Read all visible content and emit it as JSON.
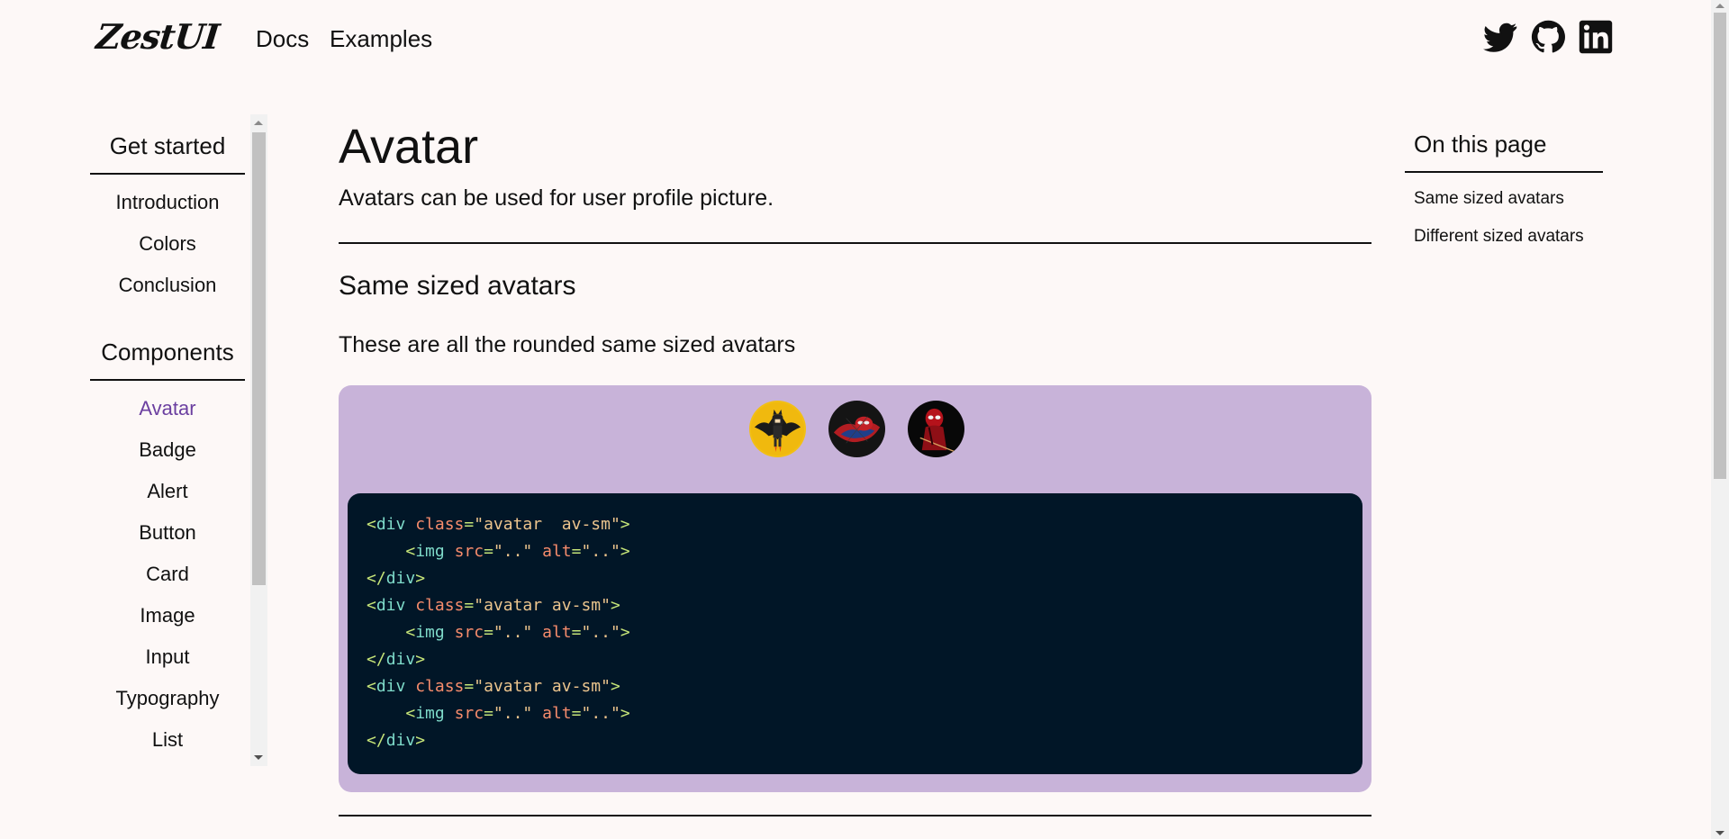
{
  "header": {
    "logo": "ZestUI",
    "nav": [
      {
        "label": "Docs"
      },
      {
        "label": "Examples"
      }
    ],
    "social_icons": [
      "twitter-icon",
      "github-icon",
      "linkedin-icon"
    ]
  },
  "sidebar": {
    "get_started_heading": "Get started",
    "get_started_items": [
      {
        "label": "Introduction"
      },
      {
        "label": "Colors"
      },
      {
        "label": "Conclusion"
      }
    ],
    "components_heading": "Components",
    "components_items": [
      {
        "label": "Avatar",
        "active": true
      },
      {
        "label": "Badge"
      },
      {
        "label": "Alert"
      },
      {
        "label": "Button"
      },
      {
        "label": "Card"
      },
      {
        "label": "Image"
      },
      {
        "label": "Input"
      },
      {
        "label": "Typography"
      },
      {
        "label": "List"
      }
    ]
  },
  "main": {
    "title": "Avatar",
    "description": "Avatars can be used for user profile picture.",
    "section_title": "Same sized avatars",
    "section_description": "These are all the rounded same sized avatars",
    "avatars": [
      "batman-avatar",
      "spiderman-avatar",
      "deadpool-avatar"
    ],
    "code_lines": [
      [
        [
          "<",
          "punc"
        ],
        [
          "div",
          "tag"
        ],
        [
          " ",
          "txt"
        ],
        [
          "class",
          "attr"
        ],
        [
          "=",
          "punc"
        ],
        [
          "\"avatar  av-sm\"",
          "str"
        ],
        [
          ">",
          "punc"
        ]
      ],
      [
        [
          "    ",
          "txt"
        ],
        [
          "<",
          "punc"
        ],
        [
          "img",
          "tag"
        ],
        [
          " ",
          "txt"
        ],
        [
          "src",
          "attr"
        ],
        [
          "=",
          "punc"
        ],
        [
          "\"..\"",
          "str"
        ],
        [
          " ",
          "txt"
        ],
        [
          "alt",
          "attr"
        ],
        [
          "=",
          "punc"
        ],
        [
          "\"..\"",
          "str"
        ],
        [
          ">",
          "punc"
        ]
      ],
      [
        [
          "</",
          "punc"
        ],
        [
          "div",
          "tag"
        ],
        [
          ">",
          "punc"
        ]
      ],
      [
        [
          "<",
          "punc"
        ],
        [
          "div",
          "tag"
        ],
        [
          " ",
          "txt"
        ],
        [
          "class",
          "attr"
        ],
        [
          "=",
          "punc"
        ],
        [
          "\"avatar av-sm\"",
          "str"
        ],
        [
          ">",
          "punc"
        ]
      ],
      [
        [
          "    ",
          "txt"
        ],
        [
          "<",
          "punc"
        ],
        [
          "img",
          "tag"
        ],
        [
          " ",
          "txt"
        ],
        [
          "src",
          "attr"
        ],
        [
          "=",
          "punc"
        ],
        [
          "\"..\"",
          "str"
        ],
        [
          " ",
          "txt"
        ],
        [
          "alt",
          "attr"
        ],
        [
          "=",
          "punc"
        ],
        [
          "\"..\"",
          "str"
        ],
        [
          ">",
          "punc"
        ]
      ],
      [
        [
          "</",
          "punc"
        ],
        [
          "div",
          "tag"
        ],
        [
          ">",
          "punc"
        ]
      ],
      [
        [
          "<",
          "punc"
        ],
        [
          "div",
          "tag"
        ],
        [
          " ",
          "txt"
        ],
        [
          "class",
          "attr"
        ],
        [
          "=",
          "punc"
        ],
        [
          "\"avatar av-sm\"",
          "str"
        ],
        [
          ">",
          "punc"
        ]
      ],
      [
        [
          "    ",
          "txt"
        ],
        [
          "<",
          "punc"
        ],
        [
          "img",
          "tag"
        ],
        [
          " ",
          "txt"
        ],
        [
          "src",
          "attr"
        ],
        [
          "=",
          "punc"
        ],
        [
          "\"..\"",
          "str"
        ],
        [
          " ",
          "txt"
        ],
        [
          "alt",
          "attr"
        ],
        [
          "=",
          "punc"
        ],
        [
          "\"..\"",
          "str"
        ],
        [
          ">",
          "punc"
        ]
      ],
      [
        [
          "</",
          "punc"
        ],
        [
          "div",
          "tag"
        ],
        [
          ">",
          "punc"
        ]
      ]
    ]
  },
  "toc": {
    "title": "On this page",
    "items": [
      {
        "label": "Same sized avatars"
      },
      {
        "label": "Different sized avatars"
      }
    ]
  },
  "colors": {
    "background": "#fdf8f7",
    "accent": "#6b3fa0",
    "demo_bg": "#c8b3d9",
    "code_bg": "#011627"
  }
}
